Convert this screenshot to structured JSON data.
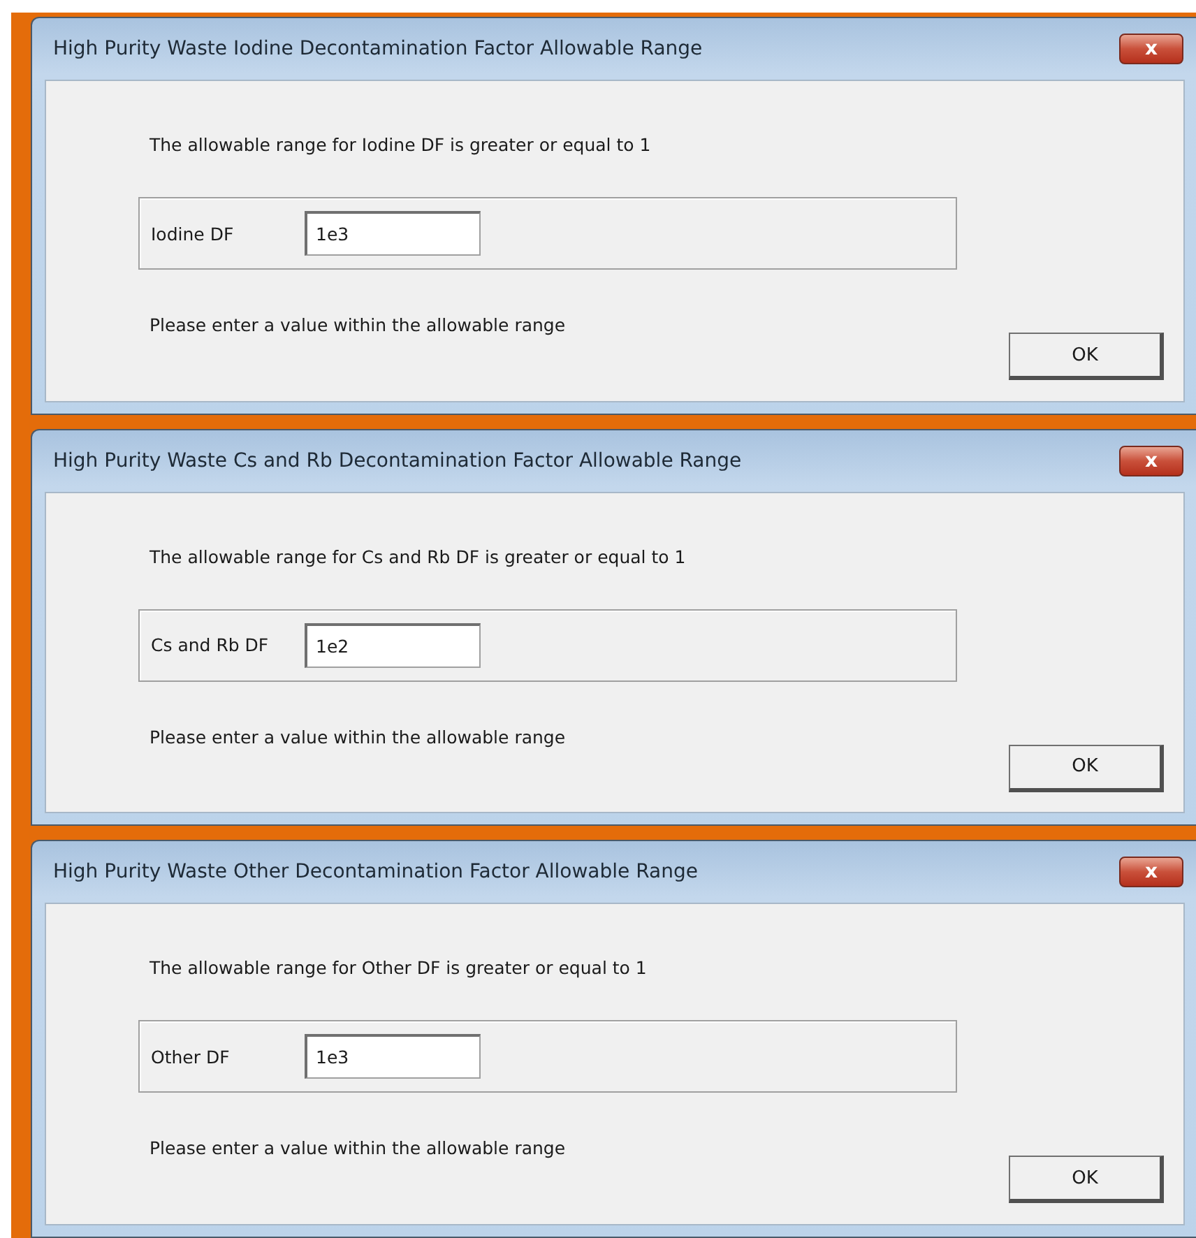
{
  "dialogs": [
    {
      "title": "High Purity Waste Iodine Decontamination Factor Allowable Range",
      "close": "x",
      "message": "The allowable range for Iodine DF is greater or equal to 1",
      "field_label": "Iodine DF",
      "field_value": "1e3",
      "note": "Please enter a value within the allowable range",
      "button": "OK"
    },
    {
      "title": "High Purity Waste Cs and Rb Decontamination Factor Allowable Range",
      "close": "x",
      "message": "The allowable range for Cs and Rb DF is greater or equal to 1",
      "field_label": "Cs and Rb DF",
      "field_value": "1e2",
      "note": "Please enter a value within the allowable range",
      "button": "OK"
    },
    {
      "title": "High Purity Waste Other Decontamination Factor Allowable Range",
      "close": "x",
      "message": "The allowable range for Other DF is greater or equal to 1",
      "field_label": "Other DF",
      "field_value": "1e3",
      "note": "Please enter a value within the allowable range",
      "button": "OK"
    }
  ]
}
